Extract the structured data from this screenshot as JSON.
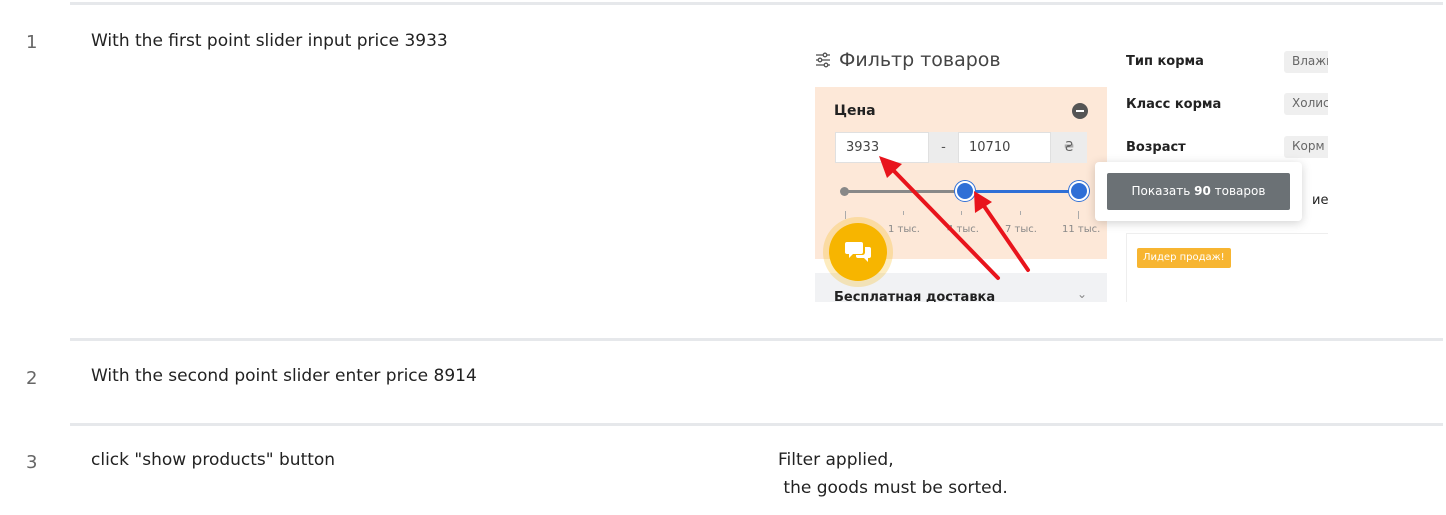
{
  "steps": [
    {
      "number": "1",
      "text": "With the first point slider input price 3933"
    },
    {
      "number": "2",
      "text": "With the second point slider enter price 8914"
    },
    {
      "number": "3",
      "text": "click \"show products\" button",
      "expected": "Filter applied,\n the goods must be sorted."
    }
  ],
  "screenshot": {
    "filter_title": "Фильтр товаров",
    "price": {
      "label": "Цена",
      "min": "3933",
      "max": "10710",
      "dash": "-",
      "currency": "₴",
      "ticks": [
        "1 тыс.",
        "4 тыс.",
        "7 тыс.",
        "11 тыс."
      ]
    },
    "free_delivery": "Бесплатная доставка",
    "attributes": [
      {
        "label": "Тип корма",
        "chip": "Влажн"
      },
      {
        "label": "Класс корма",
        "chip": "Холис"
      },
      {
        "label": "Возраст",
        "chip": "Корм"
      }
    ],
    "show_button": {
      "prefix": "Показать",
      "count": "90",
      "suffix": "товаров"
    },
    "behind_text": "ие",
    "bestseller_badge": "Лидер продаж!",
    "colors": {
      "accent": "#2f6fd6",
      "arrow": "#e8141c",
      "chat": "#f7b500",
      "panel": "#fde8d8"
    }
  }
}
